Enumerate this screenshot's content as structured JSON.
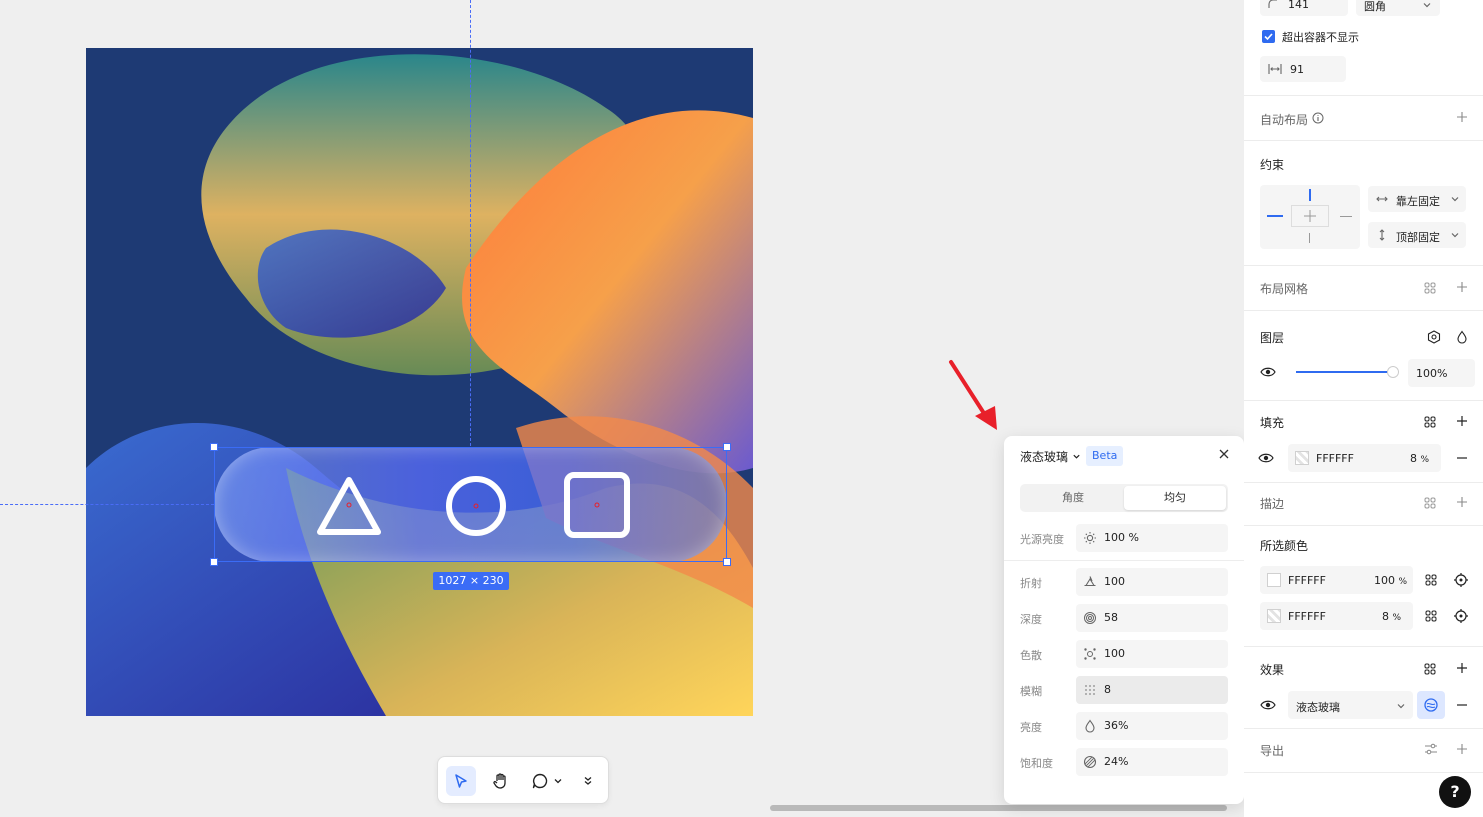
{
  "canvas": {
    "selection_size": "1027 × 230"
  },
  "toolbar": {
    "tools": [
      "move-tool",
      "hand-tool",
      "comment-tool",
      "more-tools"
    ]
  },
  "liquid_glass": {
    "title": "液态玻璃",
    "badge": "Beta",
    "tabs": [
      "角度",
      "均匀"
    ],
    "active_tab": "均匀",
    "light_label": "光源亮度",
    "light_value": "100",
    "light_unit": "%",
    "rows": [
      {
        "label": "折射",
        "value": "100",
        "icon": "refraction-icon"
      },
      {
        "label": "深度",
        "value": "58",
        "icon": "depth-icon"
      },
      {
        "label": "色散",
        "value": "100",
        "icon": "dispersion-icon"
      },
      {
        "label": "模糊",
        "value": "8",
        "icon": "blur-icon"
      },
      {
        "label": "亮度",
        "value": "36",
        "unit": "%",
        "icon": "brightness-icon"
      },
      {
        "label": "饱和度",
        "value": "24",
        "unit": "%",
        "icon": "saturation-icon"
      }
    ]
  },
  "panel": {
    "radius_value": "141",
    "corner_type": "圆角",
    "clip_label": "超出容器不显示",
    "clip_checked": true,
    "spacing_value": "91",
    "auto_layout": "自动布局",
    "constraints": "约束",
    "h_constraint": "靠左固定",
    "v_constraint": "顶部固定",
    "layout_grid": "布局网格",
    "layer": "图层",
    "layer_opacity": "100",
    "layer_opacity_unit": "%",
    "fill": "填充",
    "fill_color": "FFFFFF",
    "fill_opacity": "8",
    "fill_unit": "%",
    "stroke": "描边",
    "selected_colors": "所选颜色",
    "colors": [
      {
        "hex": "FFFFFF",
        "opacity": "100",
        "unit": "%"
      },
      {
        "hex": "FFFFFF",
        "opacity": "8",
        "unit": "%"
      }
    ],
    "effects": "效果",
    "effect_type": "液态玻璃",
    "export": "导出"
  },
  "help": "?",
  "colors": {
    "accent": "#3b6cf6",
    "arrow": "#e8202a"
  }
}
